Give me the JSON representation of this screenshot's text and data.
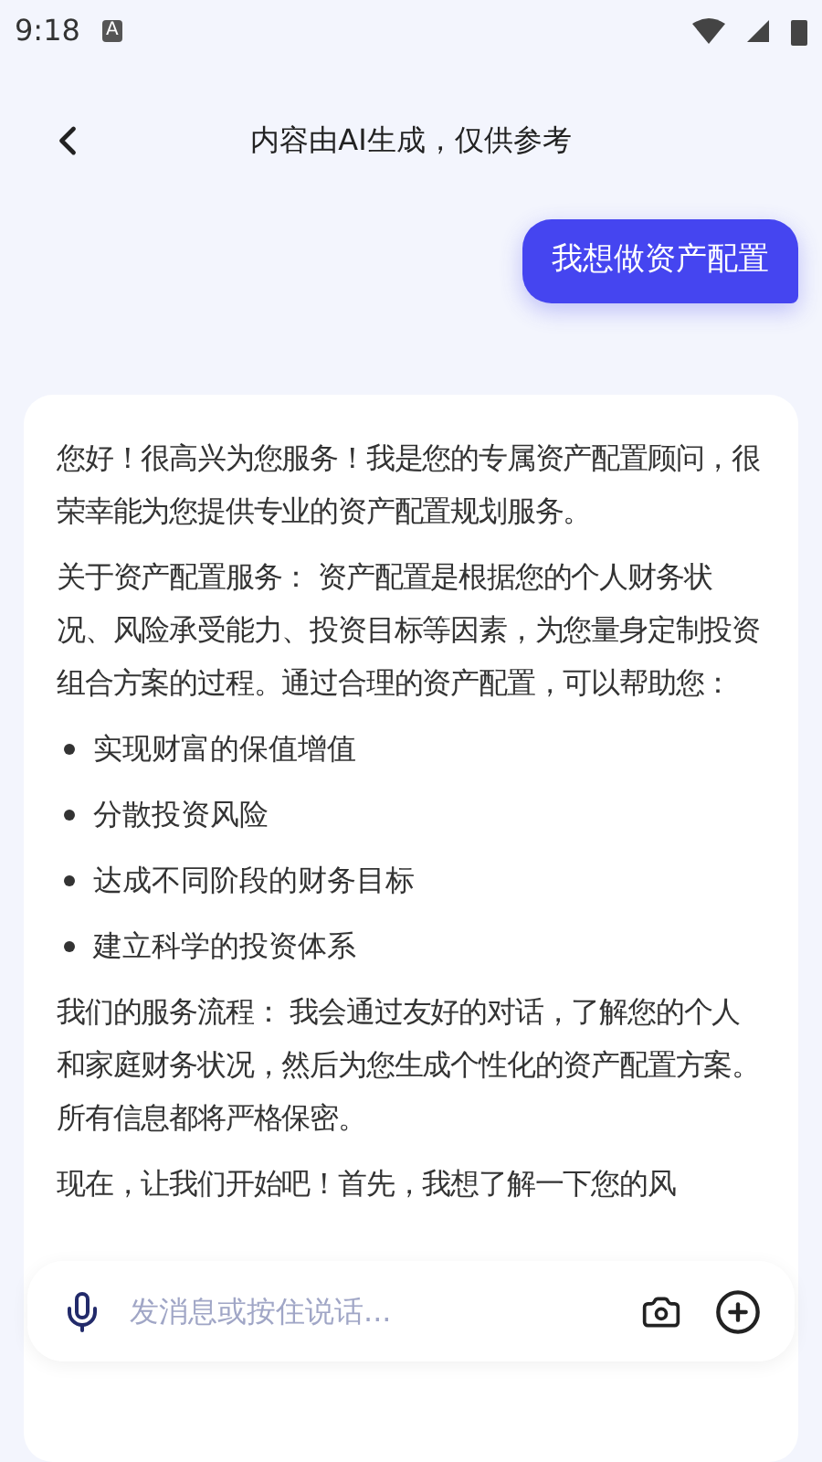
{
  "status_bar": {
    "time": "9:18",
    "badge": "A"
  },
  "header": {
    "title": "内容由AI生成，仅供参考"
  },
  "user_message": "我想做资产配置",
  "reply": [
    {
      "kind": "paragraph",
      "text": "您好！很高兴为您服务！我是您的专属资产配置顾问，很荣幸能为您提供专业的资产配置规划服务。"
    },
    {
      "kind": "paragraph",
      "text": "关于资产配置服务： 资产配置是根据您的个人财务状况、风险承受能力、投资目标等因素，为您量身定制投资组合方案的过程。通过合理的资产配置，可以帮助您："
    },
    {
      "kind": "bullet",
      "text": "实现财富的保值增值"
    },
    {
      "kind": "bullet",
      "text": "分散投资风险"
    },
    {
      "kind": "bullet",
      "text": "达成不同阶段的财务目标"
    },
    {
      "kind": "bullet",
      "text": "建立科学的投资体系"
    },
    {
      "kind": "paragraph",
      "text": "我们的服务流程： 我会通过友好的对话，了解您的个人和家庭财务状况，然后为您生成个性化的资产配置方案。所有信息都将严格保密。"
    },
    {
      "kind": "paragraph",
      "text": "现在，让我们开始吧！首先，我想了解一下您的风"
    }
  ],
  "input": {
    "placeholder": "发消息或按住说话..."
  }
}
